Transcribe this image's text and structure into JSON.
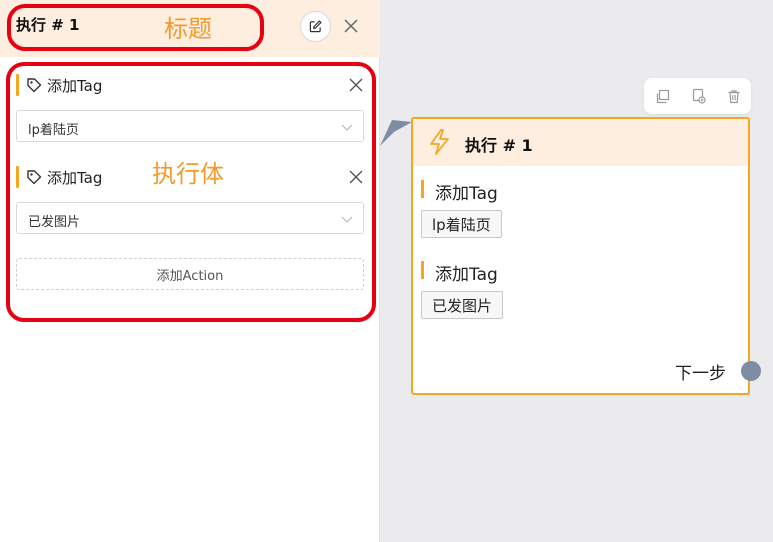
{
  "panel": {
    "title": "执行 # 1",
    "annotation_title": "标题",
    "annotation_body": "执行体",
    "tags": [
      {
        "label": "添加Tag",
        "select_value": "lp着陆页"
      },
      {
        "label": "添加Tag",
        "select_value": "已发图片"
      }
    ],
    "add_action_label": "添加Action"
  },
  "node": {
    "title": "执行 # 1",
    "items": [
      {
        "label": "添加Tag",
        "chip": "lp着陆页"
      },
      {
        "label": "添加Tag",
        "chip": "已发图片"
      }
    ],
    "next_label": "下一步"
  },
  "colors": {
    "accent": "#f5a623",
    "header_bg": "#fdeee0",
    "annotation": "#f39a2e",
    "highlight_box": "#e60012",
    "port": "#7d8da3"
  },
  "icons": [
    "edit-icon",
    "close-icon",
    "tag-icon",
    "chevron-down-icon",
    "copy-icon",
    "duplicate-icon",
    "trash-icon",
    "bolt-icon"
  ]
}
